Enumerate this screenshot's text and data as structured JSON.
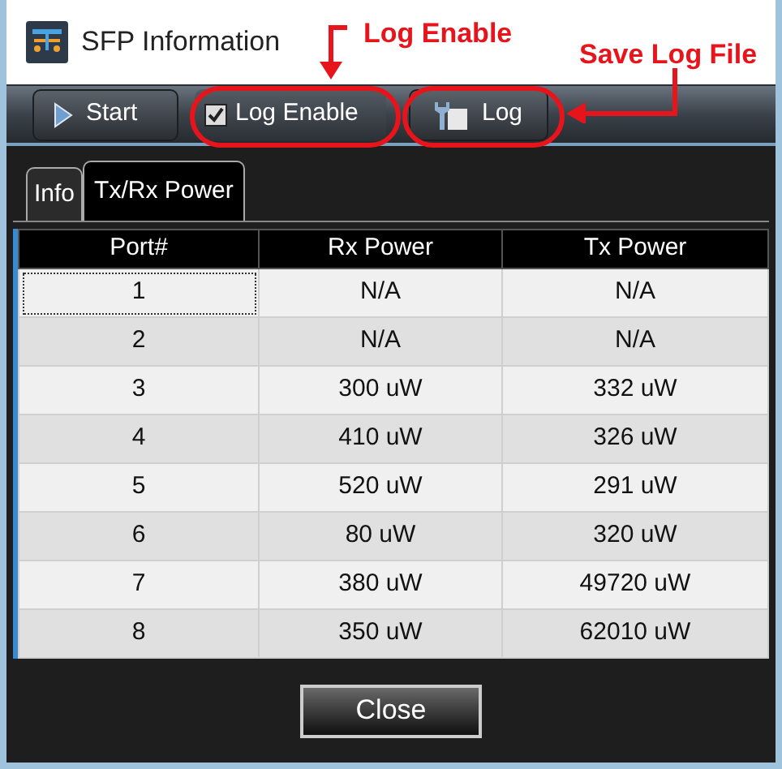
{
  "window": {
    "title": "SFP Information"
  },
  "toolbar": [
    {
      "kind": "button",
      "label": "Start"
    },
    {
      "kind": "checkbox",
      "label": "Log Enable",
      "checked": true
    },
    {
      "kind": "button",
      "label": "Log"
    }
  ],
  "tabs": [
    {
      "label": "Info",
      "selected": false
    },
    {
      "label": "Tx/Rx Power",
      "selected": true
    }
  ],
  "table": {
    "columns": [
      "Port#",
      "Rx Power",
      "Tx Power"
    ],
    "rows": [
      {
        "cells": [
          "1",
          "N/A",
          "N/A"
        ],
        "focused": true
      },
      {
        "cells": [
          "2",
          "N/A",
          "N/A"
        ],
        "focused": false
      },
      {
        "cells": [
          "3",
          "300 uW",
          "332 uW"
        ],
        "focused": false
      },
      {
        "cells": [
          "4",
          "410 uW",
          "326 uW"
        ],
        "focused": false
      },
      {
        "cells": [
          "5",
          "520 uW",
          "291 uW"
        ],
        "focused": false
      },
      {
        "cells": [
          "6",
          "80 uW",
          "320 uW"
        ],
        "focused": false
      },
      {
        "cells": [
          "7",
          "380 uW",
          "49720 uW"
        ],
        "focused": false
      },
      {
        "cells": [
          "8",
          "350 uW",
          "62010 uW"
        ],
        "focused": false
      }
    ]
  },
  "close_button": "Close",
  "annotations": [
    {
      "label": "Log Enable"
    },
    {
      "label": "Save Log File"
    }
  ]
}
